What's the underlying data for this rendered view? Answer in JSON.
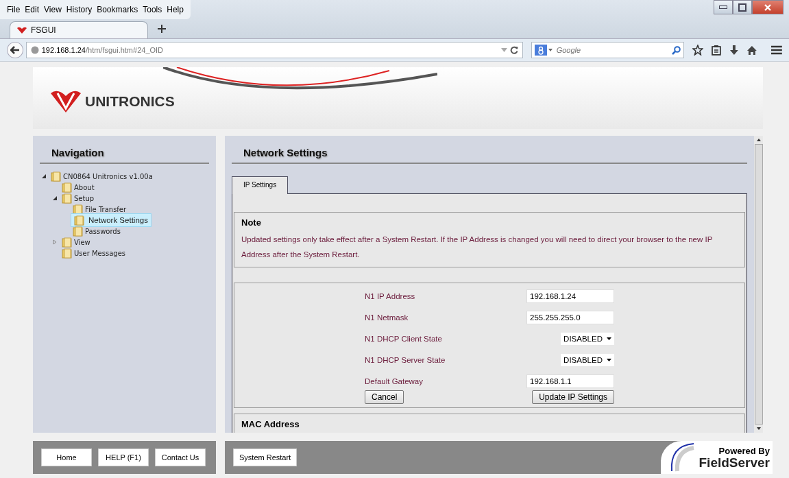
{
  "browser": {
    "menu": [
      "File",
      "Edit",
      "View",
      "History",
      "Bookmarks",
      "Tools",
      "Help"
    ],
    "tabs": [
      {
        "label": "FSGUI",
        "selected": true
      }
    ],
    "url_host": "192.168.1.24",
    "url_path": "/htm/fsgui.htm#24_OID",
    "search_placeholder": "Google"
  },
  "header": {
    "logo_text": "UNITRONICS"
  },
  "navigation": {
    "title": "Navigation",
    "tree": [
      {
        "label": "CN0864 Unitronics v1.00a",
        "selected": false,
        "expanded": true,
        "children": [
          {
            "label": "About",
            "selected": false
          },
          {
            "label": "Setup",
            "selected": false,
            "expanded": true,
            "children": [
              {
                "label": "File Transfer",
                "selected": false
              },
              {
                "label": "Network Settings",
                "selected": true
              },
              {
                "label": "Passwords",
                "selected": false
              }
            ]
          },
          {
            "label": "View",
            "selected": false,
            "expanded": false
          },
          {
            "label": "User Messages",
            "selected": false
          }
        ]
      }
    ]
  },
  "main": {
    "title": "Network Settings",
    "tabs": [
      {
        "label": "IP Settings",
        "selected": true
      }
    ],
    "note": {
      "title": "Note",
      "text": "Updated settings only take effect after a System Restart. If the IP Address is changed you will need to direct your browser to the new IP Address after the System Restart."
    },
    "fields": [
      {
        "kind": "text",
        "label": "N1 IP Address",
        "value": "192.168.1.24"
      },
      {
        "kind": "text",
        "label": "N1 Netmask",
        "value": "255.255.255.0"
      },
      {
        "kind": "select",
        "label": "N1 DHCP Client State",
        "value": "DISABLED"
      },
      {
        "kind": "select",
        "label": "N1 DHCP Server State",
        "value": "DISABLED"
      },
      {
        "kind": "text",
        "label": "Default Gateway",
        "value": "192.168.1.1"
      }
    ],
    "cancel": "Cancel",
    "update": "Update IP Settings",
    "next_section": "MAC Address"
  },
  "footer": {
    "nav_buttons": [
      "Home",
      "HELP (F1)",
      "Contact Us"
    ],
    "main_buttons": [
      "System Restart"
    ],
    "powered_by": "Powered By",
    "brand": "FieldServer"
  }
}
